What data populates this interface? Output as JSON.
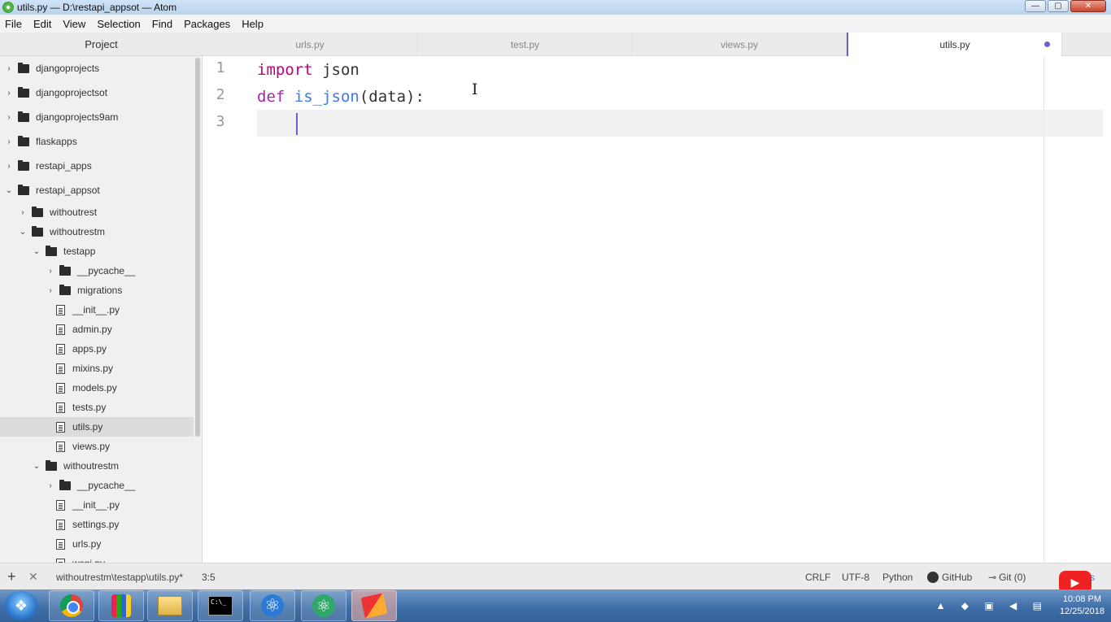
{
  "window": {
    "title": "utils.py — D:\\restapi_appsot — Atom",
    "minimize": "—",
    "maximize": "▢",
    "close": "✕"
  },
  "menu": [
    "File",
    "Edit",
    "View",
    "Selection",
    "Find",
    "Packages",
    "Help"
  ],
  "panel_title": "Project",
  "tabs": [
    {
      "label": "urls.py"
    },
    {
      "label": "test.py"
    },
    {
      "label": "views.py"
    },
    {
      "label": "utils.py",
      "active": true,
      "modified": true
    }
  ],
  "tree": [
    {
      "label": "djangoprojects",
      "type": "folder",
      "expanded": false,
      "depth": 0
    },
    {
      "label": "djangoprojectsot",
      "type": "folder",
      "expanded": false,
      "depth": 0
    },
    {
      "label": "djangoprojects9am",
      "type": "folder",
      "expanded": false,
      "depth": 0
    },
    {
      "label": "flaskapps",
      "type": "folder",
      "expanded": false,
      "depth": 0
    },
    {
      "label": "restapi_apps",
      "type": "folder",
      "expanded": false,
      "depth": 0
    },
    {
      "label": "restapi_appsot",
      "type": "folder",
      "expanded": true,
      "depth": 0
    },
    {
      "label": "withoutrest",
      "type": "folder",
      "expanded": false,
      "depth": 1
    },
    {
      "label": "withoutrestm",
      "type": "folder",
      "expanded": true,
      "depth": 1
    },
    {
      "label": "testapp",
      "type": "folder",
      "expanded": true,
      "depth": 2
    },
    {
      "label": "__pycache__",
      "type": "folder",
      "expanded": false,
      "depth": 3
    },
    {
      "label": "migrations",
      "type": "folder",
      "expanded": false,
      "depth": 3
    },
    {
      "label": "__init__.py",
      "type": "file",
      "depth": 3
    },
    {
      "label": "admin.py",
      "type": "file",
      "depth": 3
    },
    {
      "label": "apps.py",
      "type": "file",
      "depth": 3
    },
    {
      "label": "mixins.py",
      "type": "file",
      "depth": 3
    },
    {
      "label": "models.py",
      "type": "file",
      "depth": 3
    },
    {
      "label": "tests.py",
      "type": "file",
      "depth": 3
    },
    {
      "label": "utils.py",
      "type": "file",
      "depth": 3,
      "selected": true
    },
    {
      "label": "views.py",
      "type": "file",
      "depth": 3
    },
    {
      "label": "withoutrestm",
      "type": "folder",
      "expanded": true,
      "depth": 2
    },
    {
      "label": "__pycache__",
      "type": "folder",
      "expanded": false,
      "depth": 3
    },
    {
      "label": "__init__.py",
      "type": "file",
      "depth": 3
    },
    {
      "label": "settings.py",
      "type": "file",
      "depth": 3
    },
    {
      "label": "urls.py",
      "type": "file",
      "depth": 3
    },
    {
      "label": "wsgi.py",
      "type": "file",
      "depth": 3
    }
  ],
  "editor": {
    "line_numbers": [
      "1",
      "2",
      "3"
    ],
    "line1": {
      "keyword": "import",
      "rest": " json"
    },
    "line2": {
      "keyword": "def",
      "space": " ",
      "fn": "is_json",
      "rest": "(data):"
    },
    "line3": ""
  },
  "status": {
    "add_button": "+",
    "close_button": "✕",
    "file_path": "withoutrestm\\testapp\\utils.py*",
    "cursor_pos": "3:5",
    "line_ending": "CRLF",
    "encoding": "UTF-8",
    "grammar": "Python",
    "github": "GitHub",
    "git": "Git (0)",
    "git_icon": "⊸",
    "updates": "tes"
  },
  "taskbar": {
    "apps": [
      "chrome",
      "paint",
      "explorer",
      "cmd",
      "react-native",
      "atom",
      "snipping-tool"
    ],
    "cmd_text": "C:\\_",
    "tray_icons": "▲ ◆ ▣ ◀ ▤",
    "time": "10:08 PM",
    "date": "12/25/2018"
  },
  "colors": {
    "keyword_import": "#c0007a",
    "keyword_def": "#a626a4",
    "function": "#4078f2",
    "accent": "#6c5fd6"
  }
}
